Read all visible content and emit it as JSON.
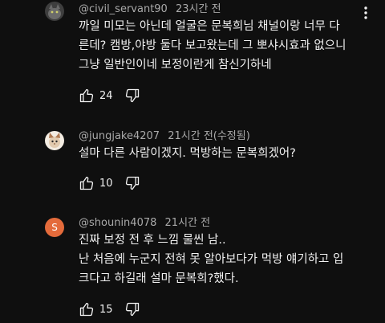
{
  "comments": [
    {
      "handle": "@civil_servant90",
      "time": "23시간 전",
      "lines": [
        "까일 미모는 아닌데 얼굴은 문복희님 채널이랑 너무 다",
        "른데? 캠방,야방 둘다 보고왔는데 그 뽀샤시효과 없으니",
        "그냥 일반인이네 보정이란게 참신기하네"
      ],
      "likes": "24",
      "avatar_icon": "cat-photo-avatar",
      "avatar_color": "#5a5a5a"
    },
    {
      "handle": "@jungjake4207",
      "time": "21시간 전(수정됨)",
      "lines": [
        "설마 다른 사람이겠지. 먹방하는 문복희겠어?"
      ],
      "likes": "10",
      "avatar_icon": "cat-photo-avatar",
      "avatar_color": "#e9dccb"
    },
    {
      "handle": "@shounin4078",
      "time": "21시간 전",
      "lines": [
        "진짜 보정 전 후 느낌 물씬 남..",
        "난 처음에 누군지 전혀 못 알아보다가 먹방 얘기하고 입",
        "크다고 하길래 설마 문복희?했다."
      ],
      "likes": "15",
      "avatar_letter": "S",
      "avatar_color": "#e46b3b"
    }
  ],
  "icons": {
    "like": "thumbs-up-icon",
    "dislike": "thumbs-down-icon",
    "menu": "more-vertical-icon"
  }
}
